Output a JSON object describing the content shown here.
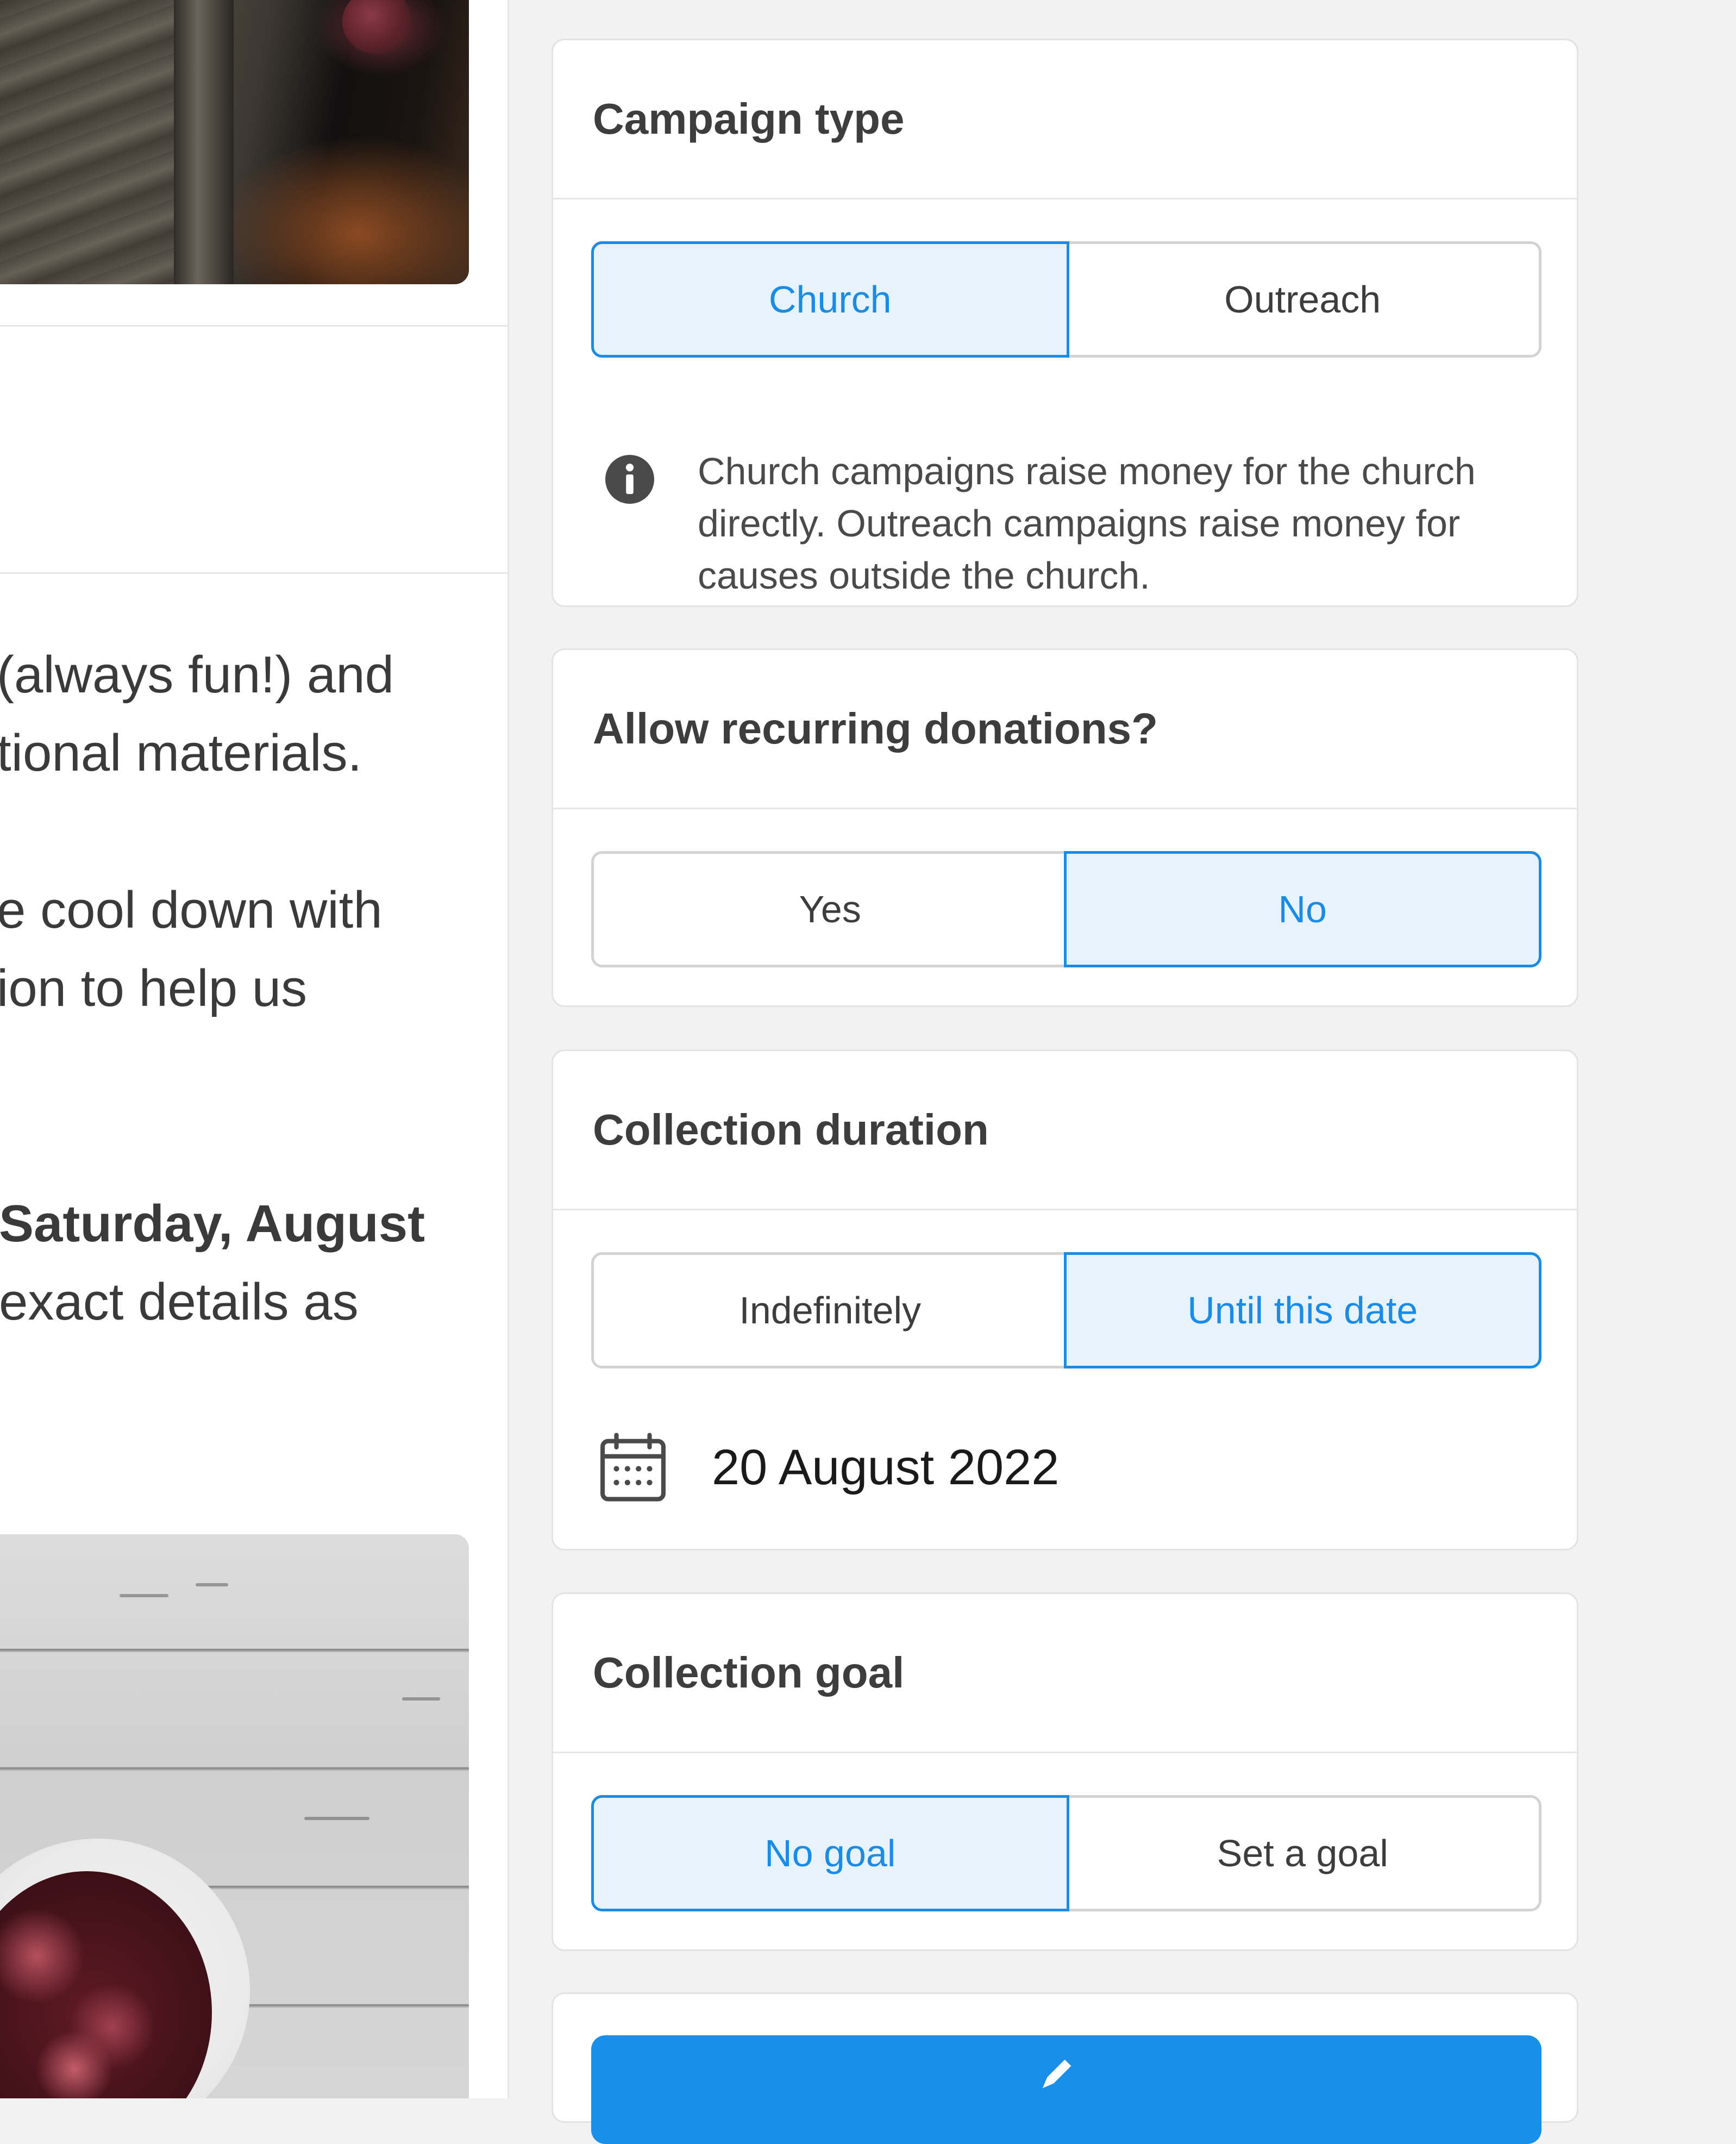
{
  "left_content": {
    "paragraphs": [
      {
        "lines": [
          "(always fun!) and",
          "tional materials."
        ]
      },
      {
        "lines": [
          "e cool down with",
          "ion to help us"
        ]
      },
      {
        "bold_line": "Saturday, August",
        "line": "exact details as"
      }
    ]
  },
  "campaign_type": {
    "title": "Campaign type",
    "options": [
      "Church",
      "Outreach"
    ],
    "selected": "Church",
    "info_text": "Church campaigns raise money for the church directly. Outreach campaigns raise money for causes outside the church."
  },
  "recurring": {
    "title": "Allow recurring donations?",
    "options": [
      "Yes",
      "No"
    ],
    "selected": "No"
  },
  "duration": {
    "title": "Collection duration",
    "options": [
      "Indefinitely",
      "Until this date"
    ],
    "selected": "Until this date",
    "date": "20 August 2022"
  },
  "goal": {
    "title": "Collection goal",
    "options": [
      "No goal",
      "Set a goal"
    ],
    "selected": "No goal"
  },
  "colors": {
    "accent": "#1b8be6",
    "selected_bg": "#e6f3fd",
    "button_bg": "#1a8fea",
    "panel_bg": "#f2f2f2"
  },
  "icons": {
    "info": "info-circle-icon",
    "calendar": "calendar-icon",
    "cta": "edit-icon"
  }
}
